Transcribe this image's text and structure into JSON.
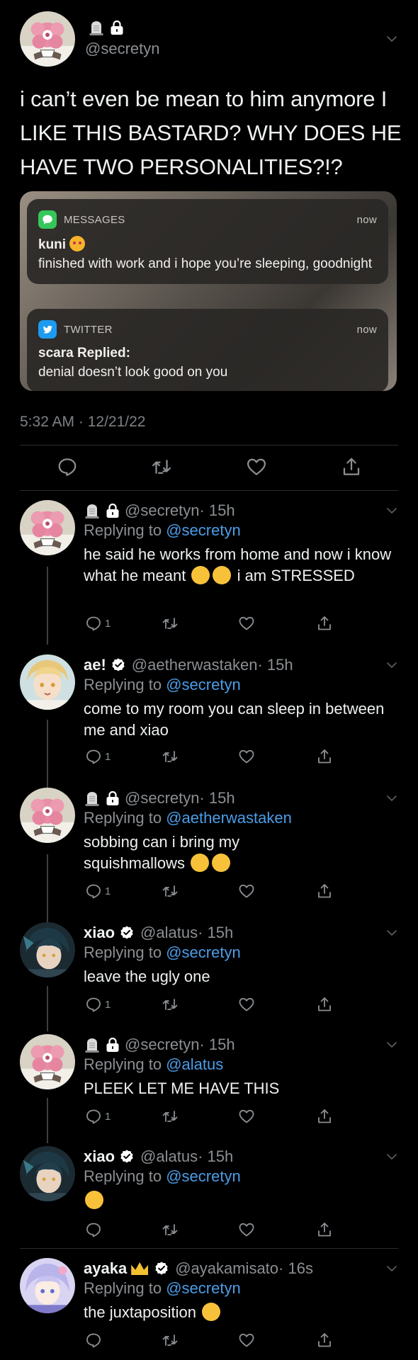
{
  "main": {
    "handle": "@secretyn",
    "text": "i can’t even be mean to him anymore I LIKE THIS BASTARD? WHY DOES HE HAVE TWO PERSONALITIES?!?",
    "timestamp": "5:32 AM · 12/21/22",
    "notifications": [
      {
        "app": "MESSAGES",
        "time": "now",
        "title": "kuni",
        "body": "finished with work and i hope you’re sleeping, goodnight",
        "icon": "messages-icon",
        "color": "#34c759"
      },
      {
        "app": "TWITTER",
        "time": "now",
        "title": "scara Replied:",
        "body": "denial doesn’t look good on you",
        "icon": "twitter-icon",
        "color": "#1d9bf0"
      }
    ]
  },
  "colors": {
    "link": "#4a9de8",
    "muted": "#8b8f93",
    "background": "#000000"
  },
  "replies": [
    {
      "name": "",
      "handle": "@secretyn",
      "time": "· 15h",
      "replying_label": "Replying to",
      "replying_to": "@secretyn",
      "text": "he said he works from home and now i know what he meant",
      "text_tail": "i am STRESSED",
      "reply_count": "1",
      "avatar": "flower"
    },
    {
      "name": "ae!",
      "handle": "@aetherwastaken",
      "time": "· 15h",
      "replying_label": "Replying to",
      "replying_to": "@secretyn",
      "text": "come to my room you can sleep in between me and xiao",
      "text_tail": "",
      "reply_count": "1",
      "avatar": "blonde"
    },
    {
      "name": "",
      "handle": "@secretyn",
      "time": "· 15h",
      "replying_label": "Replying to",
      "replying_to": "@aetherwastaken",
      "text": "sobbing can i bring my squishmallows",
      "text_tail": "",
      "reply_count": "1",
      "avatar": "flower"
    },
    {
      "name": "xiao",
      "handle": "@alatus",
      "time": "· 15h",
      "replying_label": "Replying to",
      "replying_to": "@secretyn",
      "text": "leave the ugly one",
      "text_tail": "",
      "reply_count": "1",
      "avatar": "dark"
    },
    {
      "name": "",
      "handle": "@secretyn",
      "time": "· 15h",
      "replying_label": "Replying to",
      "replying_to": "@alatus",
      "text": "PLEEK LET ME HAVE THIS",
      "text_tail": "",
      "reply_count": "1",
      "avatar": "flower"
    },
    {
      "name": "xiao",
      "handle": "@alatus",
      "time": "· 15h",
      "replying_label": "Replying to",
      "replying_to": "@secretyn",
      "text": "",
      "text_tail": "",
      "reply_count": "",
      "avatar": "dark"
    },
    {
      "name": "ayaka",
      "handle": "@ayakamisato",
      "time": "· 16s",
      "replying_label": "Replying to",
      "replying_to": "@secretyn",
      "text": "the juxtaposition",
      "text_tail": "",
      "reply_count": "",
      "avatar": "purple"
    }
  ]
}
